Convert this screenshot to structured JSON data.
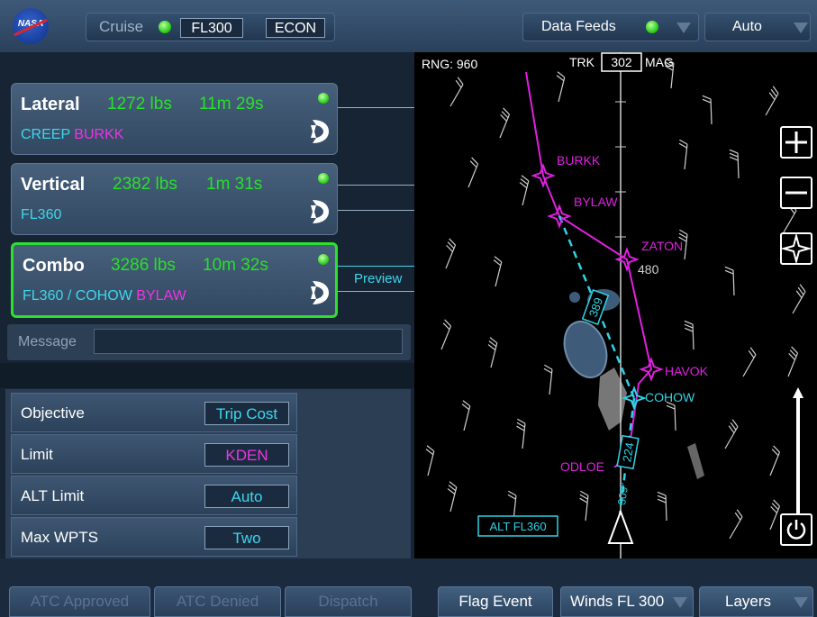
{
  "header": {
    "logo_text": "NASA",
    "mode_label": "Cruise",
    "flight_level": "FL300",
    "speed_mode": "ECON",
    "data_feeds_label": "Data Feeds",
    "auto_label": "Auto"
  },
  "routes": [
    {
      "title": "Lateral",
      "fuel": "1272 lbs",
      "time": "11m 29s",
      "path_cyan": "CREEP",
      "path_magenta": "BURKK",
      "selected": false
    },
    {
      "title": "Vertical",
      "fuel": "2382 lbs",
      "time": "1m 31s",
      "path_cyan": "FL360",
      "path_magenta": "",
      "selected": false
    },
    {
      "title": "Combo",
      "fuel": "3286 lbs",
      "time": "10m 32s",
      "path_cyan": "FL360 / COHOW",
      "path_magenta": "BYLAW",
      "selected": true
    }
  ],
  "preview_label": "Preview",
  "message": {
    "label": "Message",
    "value": ""
  },
  "parameters": [
    {
      "label": "Objective",
      "value": "Trip Cost",
      "color": "#3fd6ec"
    },
    {
      "label": "Limit",
      "value": "KDEN",
      "color": "#f033e6"
    },
    {
      "label": "ALT Limit",
      "value": "Auto",
      "color": "#3fd6ec"
    },
    {
      "label": "Max WPTS",
      "value": "Two",
      "color": "#3fd6ec"
    }
  ],
  "footer": {
    "atc_approved": "ATC Approved",
    "atc_denied": "ATC Denied",
    "dispatch": "Dispatch",
    "flag_event": "Flag Event",
    "winds": "Winds FL 300",
    "layers": "Layers"
  },
  "map": {
    "range_label": "RNG: 960",
    "track_label": "TRK",
    "track_value": "302",
    "track_ref": "MAG",
    "waypoints_magenta": [
      "BURKK",
      "BYLAW",
      "ZATON",
      "HAVOK",
      "ODLOE"
    ],
    "waypoint_cyan": "COHOW",
    "altitude_marker": "480",
    "leg_labels": [
      "389",
      "224"
    ],
    "heading_label": "309°",
    "alt_box": "ALT FL360",
    "icons": [
      "zoom-in-icon",
      "zoom-out-icon",
      "center-aircraft-icon",
      "power-icon"
    ],
    "colors": {
      "route": "#e020e0",
      "proposed": "#2fd3e6"
    }
  }
}
